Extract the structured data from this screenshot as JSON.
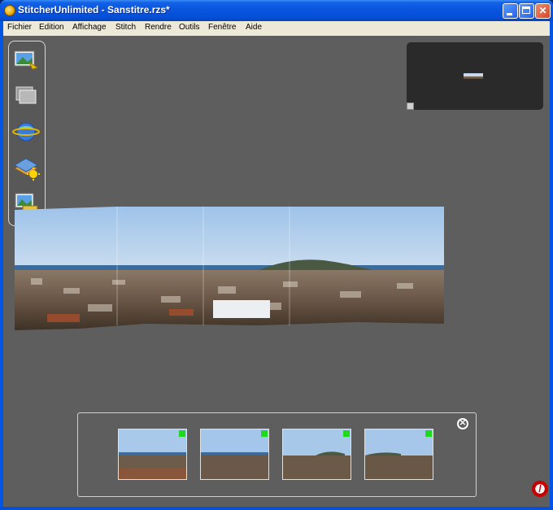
{
  "window": {
    "title": "StitcherUnlimited - Sanstitre.rzs*"
  },
  "menu": [
    "Fichier",
    "Edition",
    "Affichage",
    "Stitch",
    "Rendre",
    "Outils",
    "Fenêtre",
    "Aide"
  ],
  "toolbar": {
    "tools": [
      "add-images-icon",
      "stack-icon",
      "globe-icon",
      "layers-sun-icon",
      "render-icon"
    ]
  },
  "filmstrip": {
    "images": [
      {
        "status": "ok"
      },
      {
        "status": "ok"
      },
      {
        "status": "ok"
      },
      {
        "status": "ok"
      }
    ]
  },
  "colors": {
    "accent": "#0550d8",
    "workspace": "#5e5e5e",
    "status_ok": "#21d821"
  }
}
